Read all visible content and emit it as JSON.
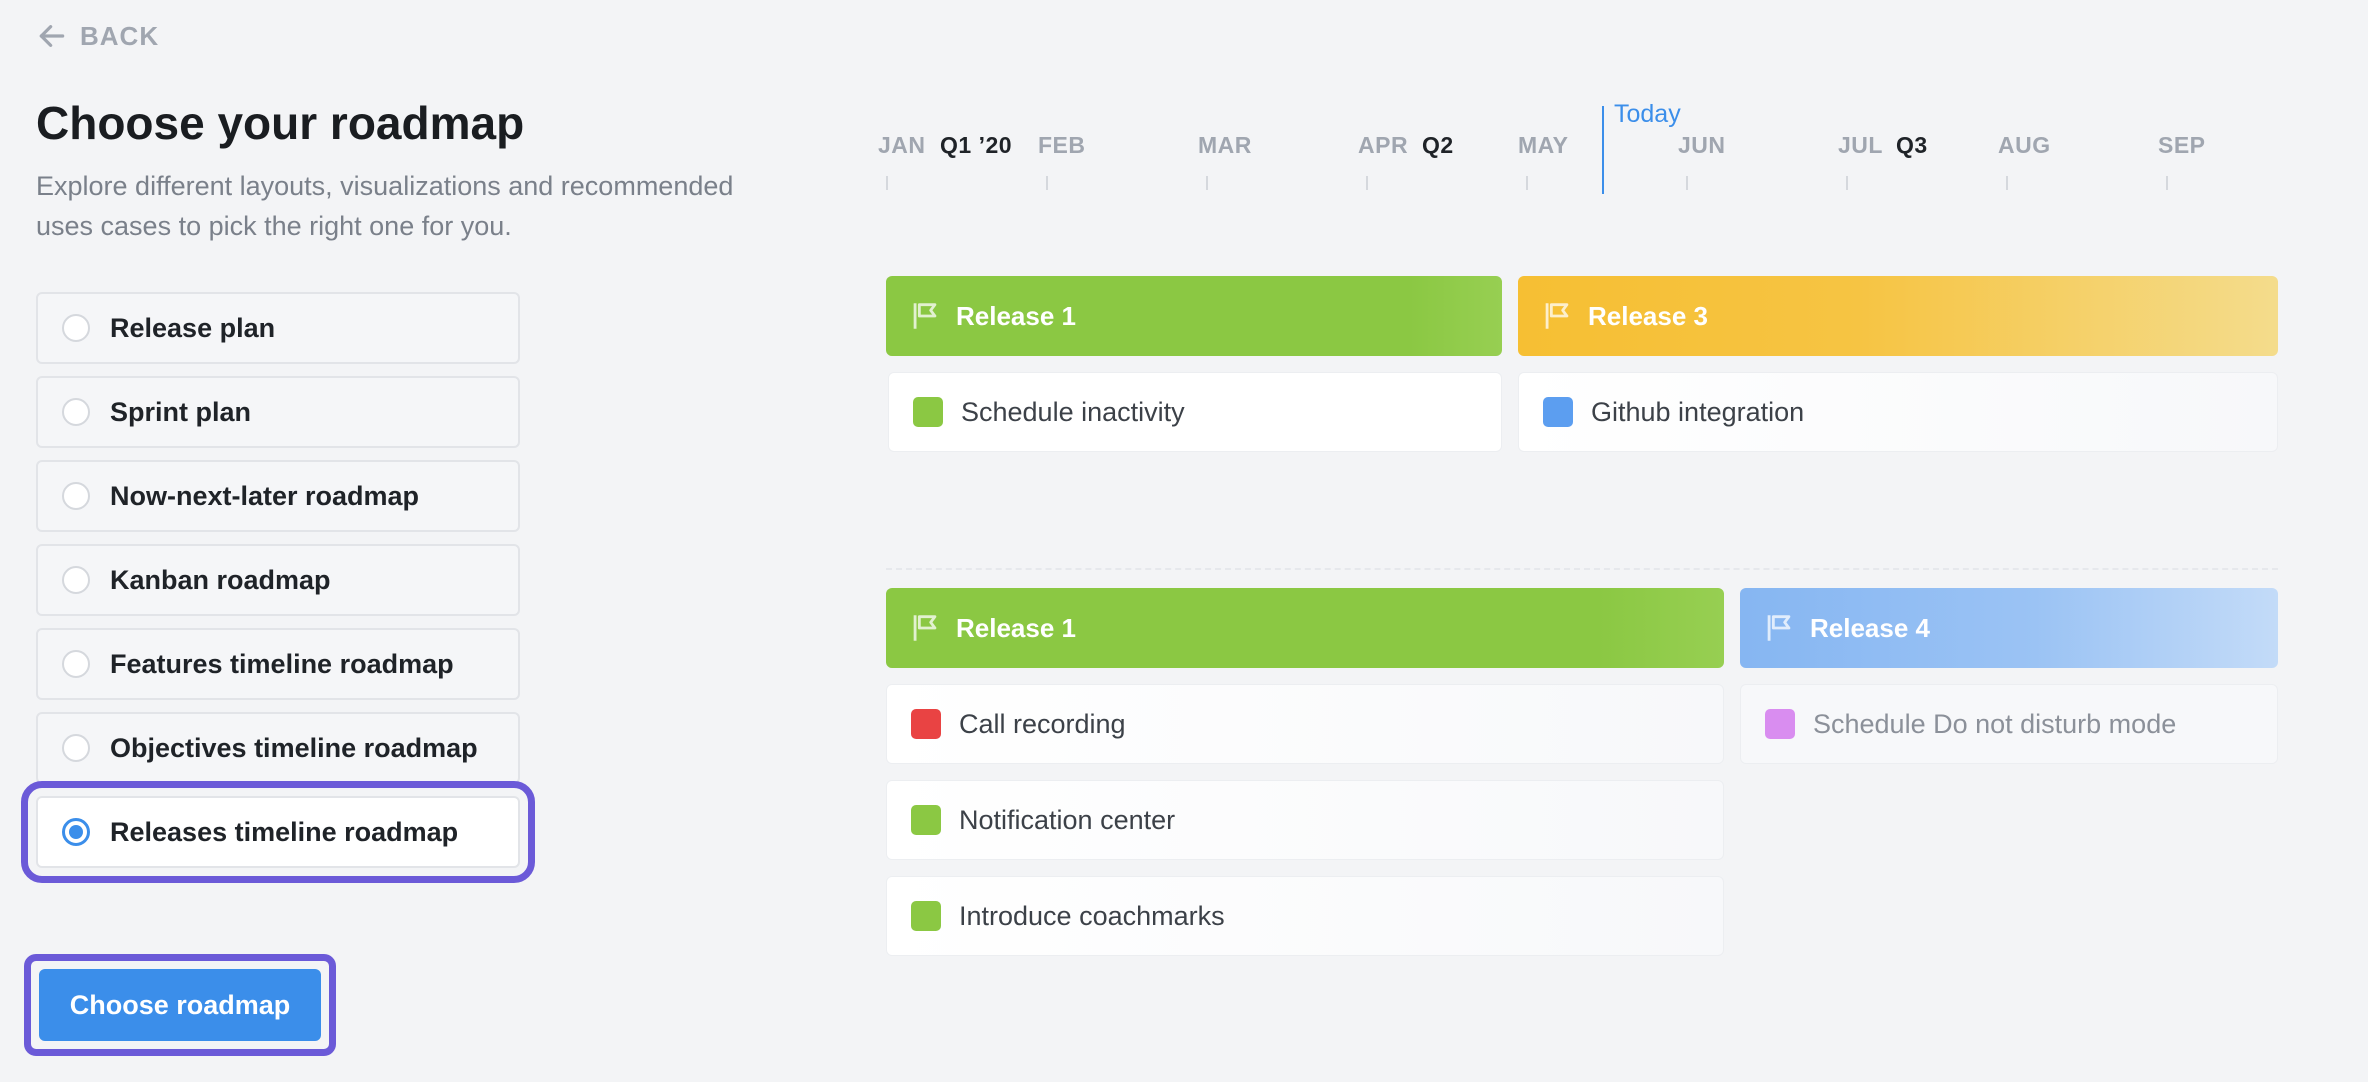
{
  "back_label": "BACK",
  "title": "Choose your roadmap",
  "subtitle": "Explore different layouts, visualizations and recommended uses cases to pick the right one for you.",
  "options": [
    {
      "label": "Release plan",
      "selected": false
    },
    {
      "label": "Sprint plan",
      "selected": false
    },
    {
      "label": "Now-next-later roadmap",
      "selected": false
    },
    {
      "label": "Kanban roadmap",
      "selected": false
    },
    {
      "label": "Features timeline roadmap",
      "selected": false
    },
    {
      "label": "Objectives timeline roadmap",
      "selected": false
    },
    {
      "label": "Releases timeline roadmap",
      "selected": true
    }
  ],
  "choose_button": "Choose roadmap",
  "timeline": {
    "months": [
      "JAN",
      "FEB",
      "MAR",
      "APR",
      "MAY",
      "JUN",
      "JUL",
      "AUG",
      "SEP"
    ],
    "quarters": [
      "Q1 ’20",
      "Q2",
      "Q3"
    ],
    "today_label": "Today"
  },
  "rows": [
    {
      "releases": [
        {
          "name": "Release 1",
          "color": "#8bc843",
          "items": [
            {
              "label": "Schedule inactivity",
              "color": "#8bc843"
            }
          ]
        },
        {
          "name": "Release 3",
          "color": "#f6bf33",
          "items": [
            {
              "label": "Github integration",
              "color": "#5c9ef0"
            }
          ]
        }
      ]
    },
    {
      "releases": [
        {
          "name": "Release 1",
          "color": "#8bc843",
          "items": [
            {
              "label": "Call recording",
              "color": "#e94343"
            },
            {
              "label": "Notification center",
              "color": "#8bc843"
            },
            {
              "label": "Introduce coachmarks",
              "color": "#8bc843"
            }
          ]
        },
        {
          "name": "Release 4",
          "color": "#86b6f2",
          "items": [
            {
              "label": "Schedule Do not disturb mode",
              "color": "#d98df0"
            }
          ]
        }
      ]
    }
  ]
}
